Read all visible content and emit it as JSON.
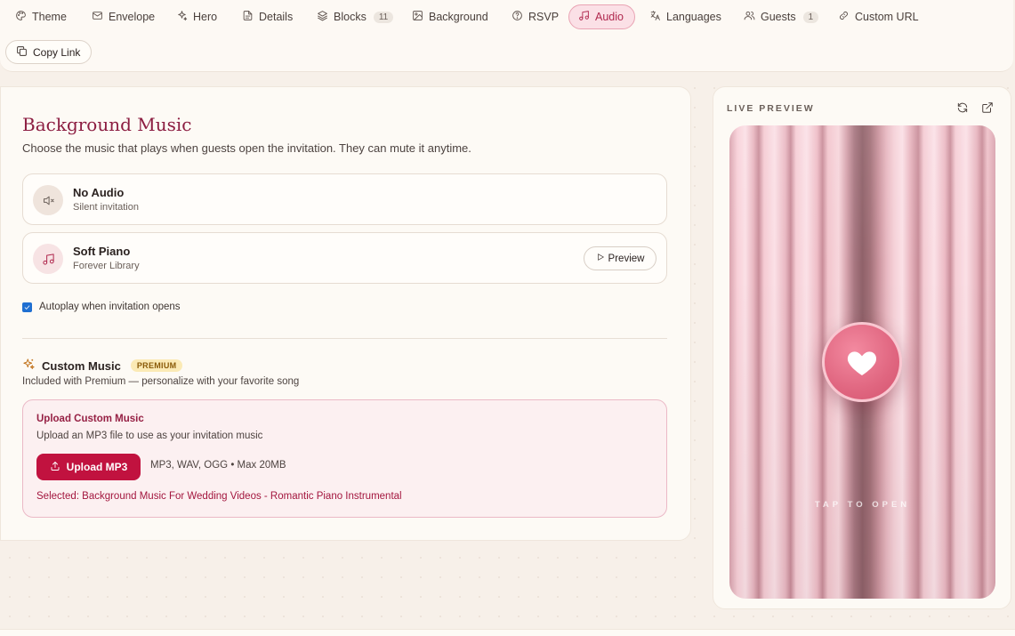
{
  "nav": {
    "tabs": [
      {
        "label": "Theme",
        "icon": "palette-icon"
      },
      {
        "label": "Envelope",
        "icon": "envelope-icon"
      },
      {
        "label": "Hero",
        "icon": "sparkle-icon"
      },
      {
        "label": "Details",
        "icon": "document-icon"
      },
      {
        "label": "Blocks",
        "icon": "layers-icon",
        "count": "11"
      },
      {
        "label": "Background",
        "icon": "image-icon"
      },
      {
        "label": "RSVP",
        "icon": "help-circle-icon"
      },
      {
        "label": "Audio",
        "icon": "music-icon",
        "active": true
      },
      {
        "label": "Languages",
        "icon": "translate-icon"
      },
      {
        "label": "Guests",
        "icon": "users-icon",
        "count": "1"
      },
      {
        "label": "Custom URL",
        "icon": "link-icon"
      }
    ],
    "copy_link": "Copy Link"
  },
  "music": {
    "title": "Background Music",
    "subtitle": "Choose the music that plays when guests open the invitation. They can mute it anytime.",
    "options": [
      {
        "name": "No Audio",
        "meta": "Silent invitation",
        "icon": "volume-mute-icon"
      },
      {
        "name": "Soft Piano",
        "meta": "Forever Library",
        "icon": "music-note-icon",
        "preview_label": "Preview"
      }
    ],
    "autoplay_label": "Autoplay when invitation opens",
    "autoplay_checked": true
  },
  "custom": {
    "title": "Custom Music",
    "badge": "PREMIUM",
    "subtitle": "Included with Premium — personalize with your favorite song",
    "upload_title": "Upload Custom Music",
    "upload_sub": "Upload an MP3 file to use as your invitation music",
    "upload_button": "Upload MP3",
    "formats": "MP3, WAV, OGG • Max 20MB",
    "selected": "Selected: Background Music For Wedding Videos - Romantic Piano Instrumental"
  },
  "preview": {
    "label": "LIVE PREVIEW",
    "tap_text": "TAP TO OPEN"
  },
  "colors": {
    "accent": "#b0284e",
    "upload_button": "#c1123f",
    "checkbox": "#1f6fd1"
  }
}
